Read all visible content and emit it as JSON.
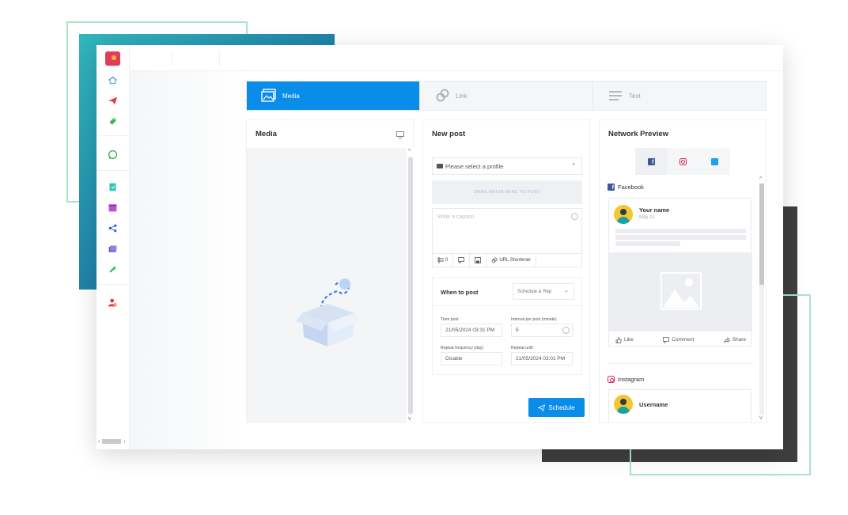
{
  "colors": {
    "accent": "#0a8ce9",
    "facebook": "#3b5998",
    "instagram": "#d6265e",
    "twitter": "#1da1f2",
    "teal": "#31b7bd",
    "dark": "#3f3f3f"
  },
  "sidebar": {
    "icons": [
      "app-logo",
      "home-icon",
      "paper-plane-icon",
      "tag-icon",
      "whatsapp-icon",
      "file-icon",
      "calendar-icon",
      "share-icon",
      "folders-icon",
      "pencil-icon",
      "users-icon"
    ]
  },
  "tabs": [
    {
      "label": "Media",
      "icon": "image-icon",
      "active": true
    },
    {
      "label": "Link",
      "icon": "link-icon",
      "active": false
    },
    {
      "label": "Text",
      "icon": "text-lines-icon",
      "active": false
    }
  ],
  "media_panel": {
    "title": "Media",
    "icon": "monitor-icon"
  },
  "post_panel": {
    "title": "New post",
    "profile_placeholder": "Please select a profile",
    "dropzone": "DRAG MEDIA HERE TO POST",
    "caption_placeholder": "Write a caption",
    "tools": {
      "count": "0",
      "url_shortener": "URL Shortener"
    },
    "when": {
      "label": "When to post",
      "option": "Schedule & Rep",
      "time_post_label": "Time post",
      "time_post_value": "21/05/2024 03:31 PM",
      "interval_label": "Interval per post (minute)",
      "interval_value": "5",
      "repeat_label": "Repeat frequency (day)",
      "repeat_value": "Disable",
      "repeat_until_label": "Repeat until",
      "repeat_until_value": "21/05/2024 03:01 PM"
    },
    "schedule_button": "Schedule"
  },
  "preview_panel": {
    "title": "Network Preview",
    "facebook": {
      "heading": "Facebook",
      "username": "Your name",
      "date": "May 21",
      "like": "Like",
      "comment": "Comment",
      "share": "Share"
    },
    "instagram": {
      "heading": "Instagram",
      "username": "Username"
    }
  }
}
